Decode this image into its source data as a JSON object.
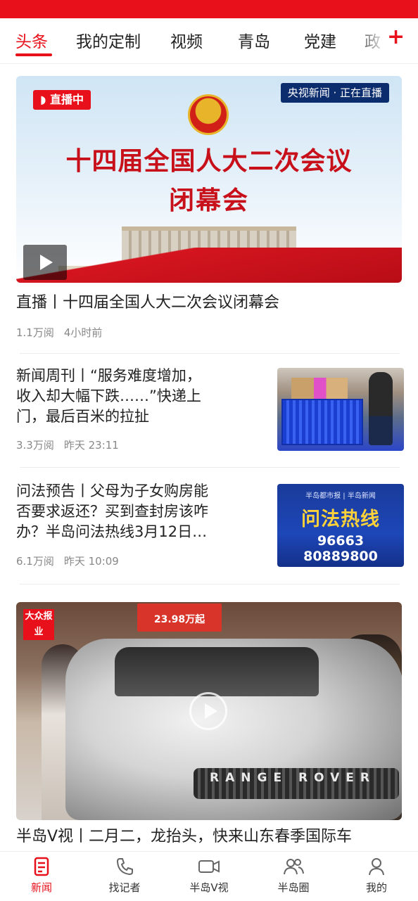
{
  "tabs": [
    {
      "label": "头条",
      "active": true
    },
    {
      "label": "我的定制",
      "active": false
    },
    {
      "label": "视频",
      "active": false
    },
    {
      "label": "青岛",
      "active": false
    },
    {
      "label": "党建",
      "active": false
    },
    {
      "label": "政",
      "active": false
    }
  ],
  "tab_add_icon": "plus-icon",
  "accent_color": "#e8101a",
  "feed": {
    "live": {
      "badge": "直播中",
      "channel_badge": "央视新闻 · 正在直播",
      "banner_line1": "十四届全国人大二次会议",
      "banner_line2": "闭幕会",
      "title": "直播丨十四届全国人大二次会议闭幕会",
      "views": "1.1万阅",
      "time": "4小时前"
    },
    "items": [
      {
        "title_lines": [
          "新闻周刊丨“服务难度增加，",
          "收入却大幅下跌……”快递上",
          "门，最后百米的拉扯"
        ],
        "views": "3.3万阅",
        "time": "昨天 23:11"
      },
      {
        "title_lines": [
          "问法预告丨父母为子女购房能",
          "否要求返还？买到查封房该咋",
          "办？半岛问法热线3月12日…"
        ],
        "views": "6.1万阅",
        "time": "昨天 10:09",
        "thumb": {
          "top": "半岛都市报 | 半岛新闻",
          "title": "问法热线",
          "phone1": "96663",
          "phone2": "80889800"
        }
      }
    ],
    "video": {
      "sign": "大众报业",
      "price": "23.98万起",
      "brand": "RANGE ROVER",
      "title": "半岛V视丨二月二，龙抬头，快来山东春季国际车"
    }
  },
  "bottom_nav": [
    {
      "label": "新闻",
      "icon": "news-icon",
      "active": true
    },
    {
      "label": "找记者",
      "icon": "phone-icon",
      "active": false
    },
    {
      "label": "半岛V视",
      "icon": "video-camera-icon",
      "active": false
    },
    {
      "label": "半岛圈",
      "icon": "community-icon",
      "active": false
    },
    {
      "label": "我的",
      "icon": "profile-icon",
      "active": false
    }
  ]
}
